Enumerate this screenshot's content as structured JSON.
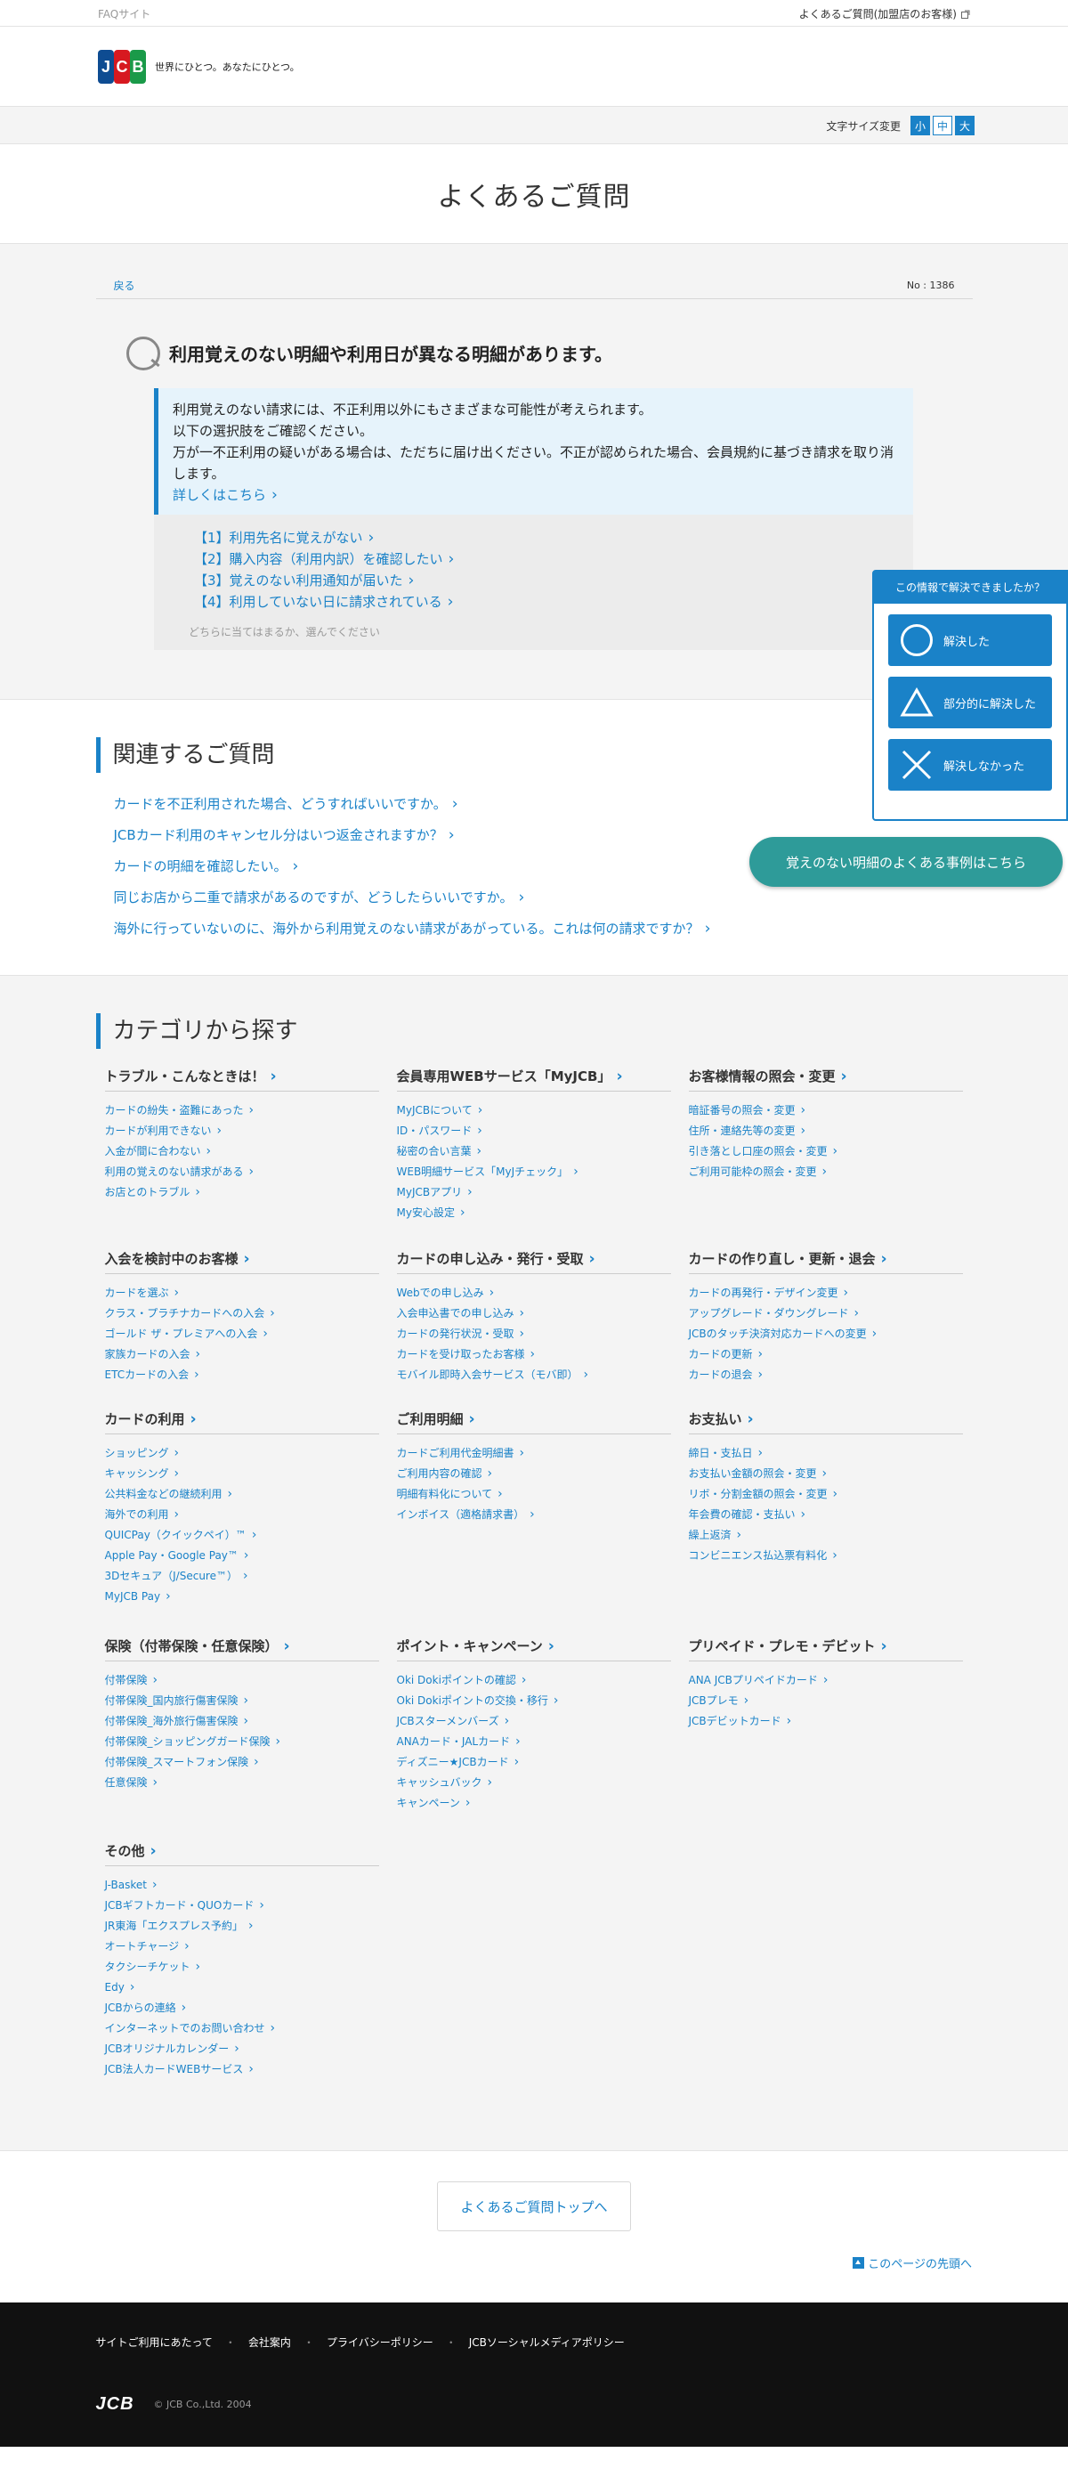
{
  "topbar": {
    "site_label": "FAQサイト",
    "member_link": "よくあるご質問(加盟店のお客様)"
  },
  "header": {
    "logo": "JCB",
    "tagline": "世界にひとつ。あなたにひとつ。"
  },
  "fontbar": {
    "label": "文字サイズ変更",
    "sizes": [
      "小",
      "中",
      "大"
    ]
  },
  "page_title": "よくあるご質問",
  "faq": {
    "back": "戻る",
    "number": "No : 1386",
    "question": "利用覚えのない明細や利用日が異なる明細があります。",
    "answer_lines": [
      "利用覚えのない請求には、不正利用以外にもさまざまな可能性が考えられます。",
      "以下の選択肢をご確認ください。",
      "万が一不正利用の疑いがある場合は、ただちに届け出ください。不正が認められた場合、会員規約に基づき請求を取り消します。"
    ],
    "more": "詳しくはこちら",
    "choices": [
      "【1】利用先名に覚えがない",
      "【2】購入内容（利用内訳）を確認したい",
      "【3】覚えのない利用通知が届いた",
      "【4】利用していない日に請求されている"
    ],
    "hint": "どちらに当てはまるか、選んでください"
  },
  "feedback": {
    "title": "この情報で解決できましたか？",
    "buttons": [
      "解決した",
      "部分的に解決した",
      "解決しなかった"
    ]
  },
  "cases_button": "覚えのない明細のよくある事例はこちら",
  "related": {
    "heading": "関連するご質問",
    "items": [
      "カードを不正利用された場合、どうすればいいですか。",
      "JCBカード利用のキャンセル分はいつ返金されますか？",
      "カードの明細を確認したい。",
      "同じお店から二重で請求があるのですが、どうしたらいいですか。",
      "海外に行っていないのに、海外から利用覚えのない請求があがっている。これは何の請求ですか？"
    ]
  },
  "category": {
    "heading": "カテゴリから探す",
    "groups": [
      {
        "title": "トラブル・こんなときは！",
        "items": [
          "カードの紛失・盗難にあった",
          "カードが利用できない",
          "入金が間に合わない",
          "利用の覚えのない請求がある",
          "お店とのトラブル"
        ]
      },
      {
        "title": "会員専用WEBサービス「MyJCB」",
        "items": [
          "MyJCBについて",
          "ID・パスワード",
          "秘密の合い言葉",
          "WEB明細サービス「MyJチェック」",
          "MyJCBアプリ",
          "My安心設定"
        ]
      },
      {
        "title": "お客様情報の照会・変更",
        "items": [
          "暗証番号の照会・変更",
          "住所・連絡先等の変更",
          "引き落とし口座の照会・変更",
          "ご利用可能枠の照会・変更"
        ]
      },
      {
        "title": "入会を検討中のお客様",
        "items": [
          "カードを選ぶ",
          "クラス・プラチナカードへの入会",
          "ゴールド ザ・プレミアへの入会",
          "家族カードの入会",
          "ETCカードの入会"
        ]
      },
      {
        "title": "カードの申し込み・発行・受取",
        "items": [
          "Webでの申し込み",
          "入会申込書での申し込み",
          "カードの発行状況・受取",
          "カードを受け取ったお客様",
          "モバイル即時入会サービス（モバ即）"
        ]
      },
      {
        "title": "カードの作り直し・更新・退会",
        "items": [
          "カードの再発行・デザイン変更",
          "アップグレード・ダウングレード",
          "JCBのタッチ決済対応カードへの変更",
          "カードの更新",
          "カードの退会"
        ]
      },
      {
        "title": "カードの利用",
        "items": [
          "ショッピング",
          "キャッシング",
          "公共料金などの継続利用",
          "海外での利用",
          "QUICPay（クイックペイ）™",
          "Apple Pay・Google Pay™",
          "3Dセキュア（J/Secure™）",
          "MyJCB Pay"
        ]
      },
      {
        "title": "ご利用明細",
        "items": [
          "カードご利用代金明細書",
          "ご利用内容の確認",
          "明細有料化について",
          "インボイス（適格請求書）"
        ]
      },
      {
        "title": "お支払い",
        "items": [
          "締日・支払日",
          "お支払い金額の照会・変更",
          "リボ・分割金額の照会・変更",
          "年会費の確認・支払い",
          "繰上返済",
          "コンビニエンス払込票有料化"
        ]
      },
      {
        "title": "保険（付帯保険・任意保険）",
        "items": [
          "付帯保険",
          "付帯保険_国内旅行傷害保険",
          "付帯保険_海外旅行傷害保険",
          "付帯保険_ショッピングガード保険",
          "付帯保険_スマートフォン保険",
          "任意保険"
        ]
      },
      {
        "title": "ポイント・キャンペーン",
        "items": [
          "Oki Dokiポイントの確認",
          "Oki Dokiポイントの交換・移行",
          "JCBスターメンバーズ",
          "ANAカード・JALカード",
          "ディズニー★JCBカード",
          "キャッシュバック",
          "キャンペーン"
        ]
      },
      {
        "title": "プリペイド・プレモ・デビット",
        "items": [
          "ANA JCBプリペイドカード",
          "JCBプレモ",
          "JCBデビットカード"
        ]
      },
      {
        "title": "その他",
        "items": [
          "J-Basket",
          "JCBギフトカード・QUOカード",
          "JR東海「エクスプレス予約」",
          "オートチャージ",
          "タクシーチケット",
          "Edy",
          "JCBからの連絡",
          "インターネットでのお問い合わせ",
          "JCBオリジナルカレンダー",
          "JCB法人カードWEBサービス"
        ]
      }
    ]
  },
  "faq_top_button": "よくあるご質問トップへ",
  "page_top": "このページの先頭へ",
  "footer": {
    "links": [
      "サイトご利用にあたって",
      "会社案内",
      "プライバシーポリシー",
      "JCBソーシャルメディアポリシー"
    ],
    "logo": "JCB",
    "copyright": "© JCB Co.,Ltd. 2004"
  }
}
